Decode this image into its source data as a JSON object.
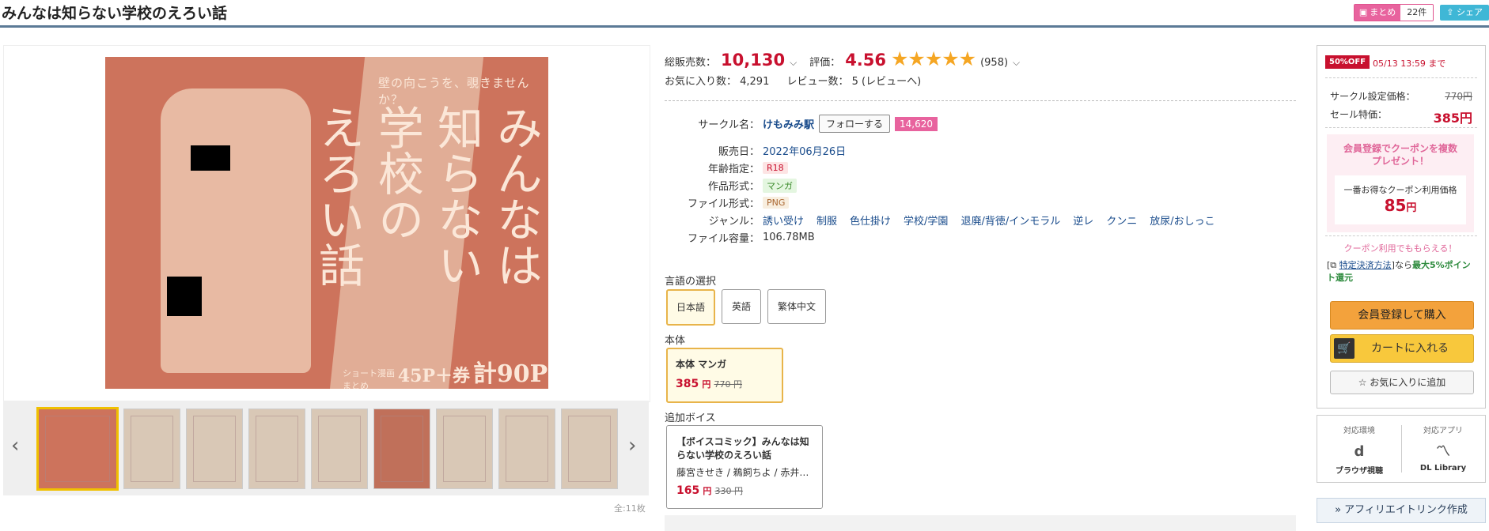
{
  "title": "みんなは知らない学校のえろい話",
  "header": {
    "matome_label": "まとめ",
    "matome_count": "22件",
    "share_label": "シェア"
  },
  "cover": {
    "tagline": "壁の向こうを、覗きませんか？",
    "title_columns": [
      "みんなは",
      "知らない",
      "学校の",
      "えろい話"
    ],
    "footer_prefix": "ショート漫画\nまとめ",
    "footer_pages": "45P＋",
    "footer_bonus": "券",
    "footer_total": "計90P"
  },
  "gallery": {
    "count_label": "全:11枚"
  },
  "stats": {
    "sales_label": "総販売数：",
    "sales_value": "10,130",
    "rating_label": "評価：",
    "rating_value": "4.56",
    "stars": "★★★★★",
    "rating_count": "(958)",
    "favorites": "お気に入り数：  4,291",
    "reviews": "レビュー数：  5 (レビューへ)"
  },
  "details": {
    "circle_label": "サークル名：",
    "circle_value": "けもみみ駅",
    "follow_label": "フォローする",
    "follow_count": "14,620",
    "release_label": "販売日：",
    "release_value": "2022年06月26日",
    "age_label": "年齢指定：",
    "age_value": "R18",
    "format_label": "作品形式：",
    "format_value": "マンガ",
    "file_label": "ファイル形式：",
    "file_value": "PNG",
    "genre_label": "ジャンル：",
    "genres": [
      "誘い受け",
      "制服",
      "色仕掛け",
      "学校/学園",
      "退廃/背徳/インモラル",
      "逆レ",
      "クンニ",
      "放尿/おしっこ"
    ],
    "size_label": "ファイル容量：",
    "size_value": "106.78MB"
  },
  "language": {
    "label": "言語の選択",
    "options": [
      "日本語",
      "英語",
      "繁体中文"
    ],
    "selected": "日本語"
  },
  "edition": {
    "section_label": "本体",
    "name": "本体 マンガ",
    "price": "385",
    "unit": "円",
    "original": "770 円"
  },
  "voice": {
    "section_label": "追加ボイス",
    "name": "【ボイスコミック】みんなは知らない学校のえろい話",
    "actors": "藤宮きせき / 鵜飼ちよ / 赤井…",
    "price": "165",
    "unit": "円",
    "original": "330 円"
  },
  "sidebar": {
    "sale_badge": "50%OFF",
    "sale_until": "05/13 13:59 まで",
    "list_price_label": "サークル設定価格：",
    "list_price": "770円",
    "sale_price_label": "セール特価：",
    "sale_price": "385円",
    "coupon_title": "会員登録でクーポンを複数\nプレゼント！",
    "coupon_sub": "一番お得なクーポン利用価格",
    "coupon_price": "85",
    "coupon_unit": "円",
    "points_title": "クーポン利用でももらえる！",
    "points_link": "特定決済方法",
    "points_suffix": "なら",
    "points_bonus": "最大5%ポイント還元",
    "buy_label": "会員登録して購入",
    "cart_label": "カートに入れる",
    "fav_label": "お気に入りに追加"
  },
  "env": {
    "env_label": "対応環境",
    "env_value": "ブラウザ視聴",
    "app_label": "対応アプリ",
    "app_value": "DL Library"
  },
  "affiliate": {
    "label": "» アフィリエイトリンク作成"
  }
}
